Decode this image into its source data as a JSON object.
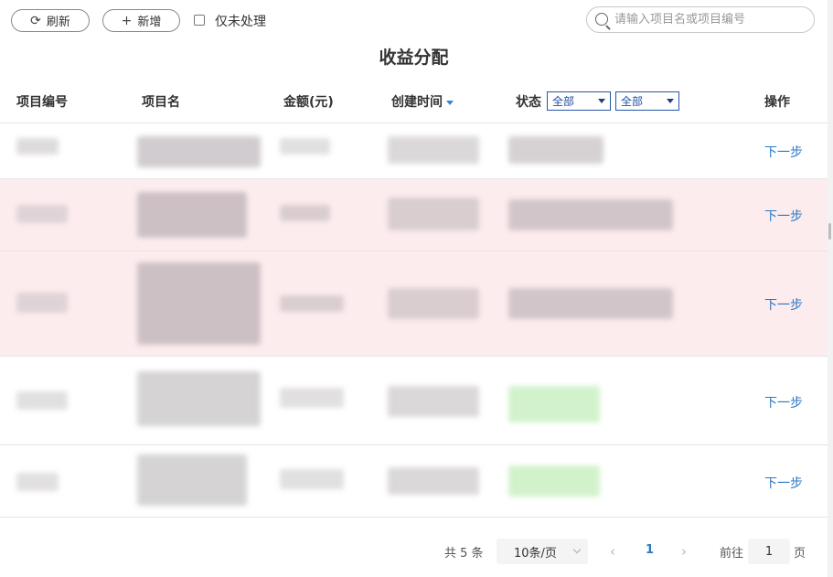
{
  "toolbar": {
    "refresh_label": "刷新",
    "add_label": "新增",
    "only_unprocessed_label": "仅未处理",
    "only_unprocessed_checked": false,
    "search_placeholder": "请输入项目名或项目编号",
    "search_value": ""
  },
  "page_title": "收益分配",
  "table": {
    "columns": {
      "code": "项目编号",
      "name": "项目名",
      "amount": "金额(元)",
      "created": "创建时间",
      "status": "状态",
      "action": "操作"
    },
    "status_filter_1": "全部",
    "status_filter_2": "全部",
    "rows": [
      {
        "action": "下一步",
        "highlighted": false
      },
      {
        "action": "下一步",
        "highlighted": true
      },
      {
        "action": "下一步",
        "highlighted": true
      },
      {
        "action": "下一步",
        "highlighted": false
      },
      {
        "action": "下一步",
        "highlighted": false
      }
    ]
  },
  "pagination": {
    "total": "共 5 条",
    "page_size": "10条/页",
    "current_page": "1",
    "goto_label": "前往",
    "goto_value": "1",
    "page_suffix": "页"
  },
  "colors": {
    "link_blue": "#2a78c8",
    "highlight_row": "#fdecee",
    "filter_border": "#2356a8"
  }
}
